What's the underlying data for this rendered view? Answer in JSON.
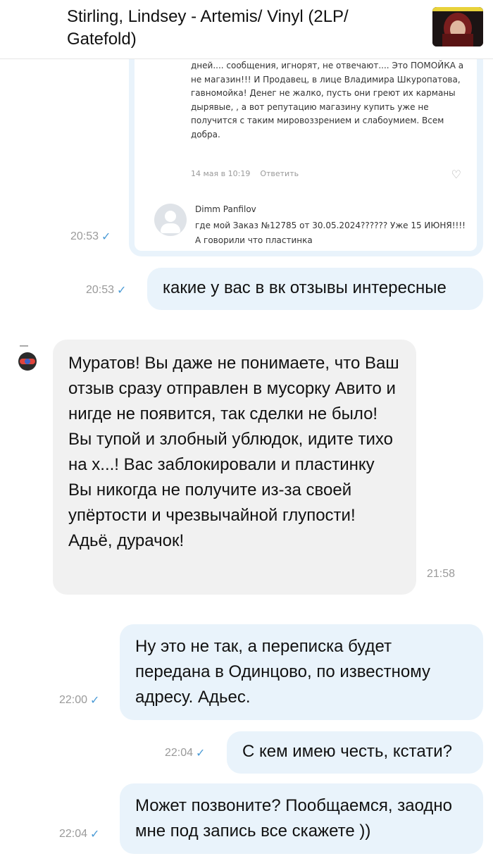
{
  "header": {
    "title": "Stirling, Lindsey - Artemis/ Vinyl (2LP/ Gatefold)",
    "thumbnail_icon": "album-cover-thumbnail"
  },
  "quoted_screenshot": {
    "review_text": "дней.... сообщения, игнорят, не отвечают.... Это ПОМОЙКА а не магазин!!! И Продавец, в лице Владимира Шкуропатова, гавномойка! Денег не жалко, пусть они греют их карманы дырявые, , а вот репутацию магазину купить уже не получится с таким мировоззрением и слабоумием. Всем добра.",
    "review_date": "14 мая в 10:19",
    "reply_action": "Ответить",
    "commenter_name": "Dimm Panfilov",
    "commenter_text": "где мой Заказ №12785 от 30.05.2024?????? Уже 15 ИЮНЯ!!!! А говорили что пластинка"
  },
  "messages": [
    {
      "direction": "out",
      "time": "20:53",
      "kind": "image"
    },
    {
      "direction": "out",
      "time": "20:53",
      "text": "какие у вас в вк отзывы интересные"
    },
    {
      "direction": "in",
      "time": "21:58",
      "text": "Муратов! Вы даже не понимаете, что Ваш отзыв сразу отправлен в мусорку Авито и нигде не появится, так сделки не было! Вы тупой и злобный ублюдок, идите тихо на х...! Вас заблокировали и пластинку Вы никогда не получите из-за своей упёртости и чрезвычайной глупости! Адьё, дурачок!"
    },
    {
      "direction": "out",
      "time": "22:00",
      "text": "Ну это не так, а переписка будет передана в Одинцово, по известному адресу. Адьес."
    },
    {
      "direction": "out",
      "time": "22:04",
      "text": "С кем имею честь, кстати?"
    },
    {
      "direction": "out",
      "time": "22:04",
      "text": "Может позвоните? Пообщаемся, заодно мне под запись все скажете ))"
    }
  ],
  "icons": {
    "read_status": "check-icon",
    "like": "heart-icon"
  },
  "colors": {
    "outgoing_bubble": "#e9f3fb",
    "incoming_bubble": "#f1f1f1",
    "check": "#4b9bd6"
  }
}
